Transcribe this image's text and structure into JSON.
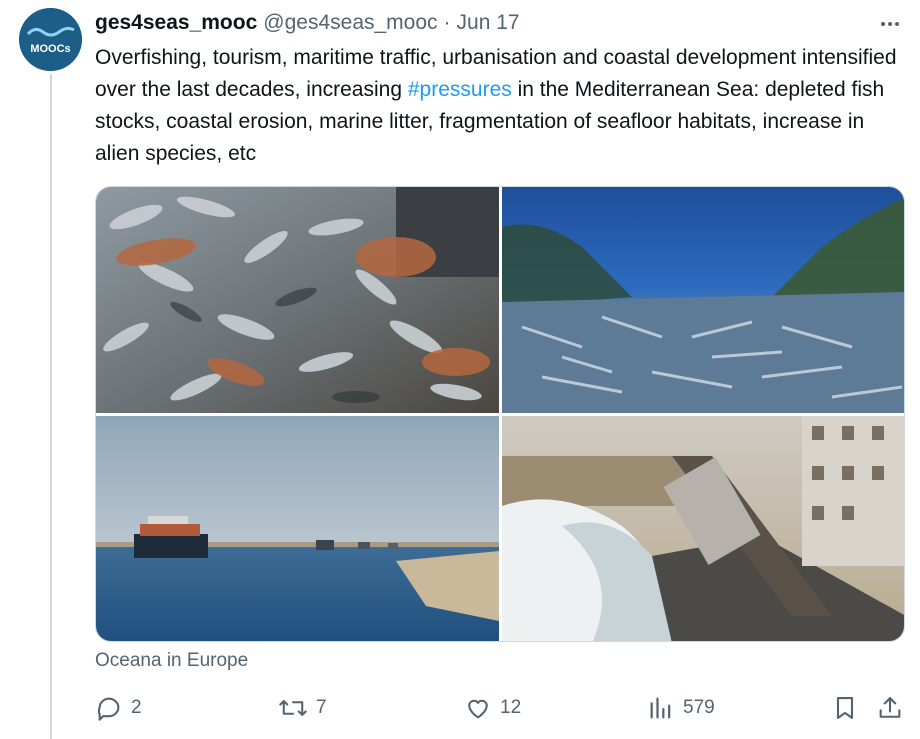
{
  "tweet": {
    "author_name": "ges4seas_mooc",
    "handle": "@ges4seas_mooc",
    "separator": "·",
    "date": "Jun 17",
    "avatar_text": "MOOCs",
    "text_before": "Overfishing, tourism, maritime traffic, urbanisation and coastal development intensified over the last decades, increasing ",
    "hashtag": "#pressures",
    "text_after": " in the Mediterranean Sea: depleted fish stocks, coastal erosion, marine litter, fragmentation of seafloor habitats, increase in alien species, etc",
    "media_source": "Oceana in Europe"
  },
  "media": [
    {
      "name": "photo-fish-catch",
      "icon": "photo"
    },
    {
      "name": "photo-seagrass-seafloor",
      "icon": "photo"
    },
    {
      "name": "photo-container-ships-canal",
      "icon": "photo"
    },
    {
      "name": "photo-coastal-waves-train",
      "icon": "photo"
    }
  ],
  "actions": {
    "replies": "2",
    "reposts": "7",
    "likes": "12",
    "views": "579"
  },
  "icons": {
    "reply": "reply-icon",
    "repost": "repost-icon",
    "like": "heart-icon",
    "views": "views-icon",
    "bookmark": "bookmark-icon",
    "share": "share-icon",
    "more": "more-icon"
  },
  "colors": {
    "accent": "#1d9bf0",
    "secondary_text": "#536471",
    "avatar_bg": "#1c5e87"
  }
}
